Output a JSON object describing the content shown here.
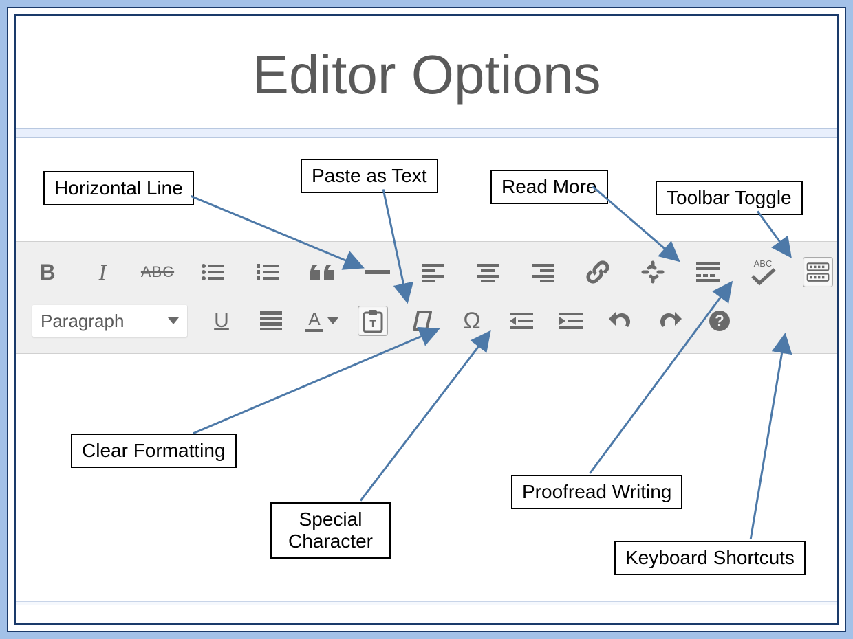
{
  "title": "Editor Options",
  "paragraph_select": {
    "label": "Paragraph"
  },
  "callouts": {
    "horizontal_line": "Horizontal Line",
    "paste_as_text": "Paste as Text",
    "read_more": "Read More",
    "toolbar_toggle": "Toolbar Toggle",
    "clear_formatting": "Clear Formatting",
    "special_character": "Special\nCharacter",
    "proofread_writing": "Proofread Writing",
    "keyboard_shortcuts": "Keyboard Shortcuts"
  },
  "row1": {
    "bold": "B",
    "italic": "I",
    "strike": "ABC",
    "abc_label": "ABC"
  },
  "row2": {
    "underline": "U",
    "textcolor": "A",
    "omega": "Ω",
    "help": "?"
  }
}
